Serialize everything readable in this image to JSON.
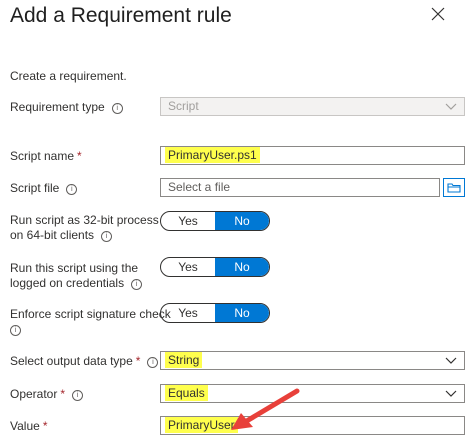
{
  "header": {
    "title": "Add a Requirement rule",
    "close_icon": "close-icon"
  },
  "intro": "Create a requirement.",
  "fields": {
    "requirement_type": {
      "label": "Requirement type",
      "value": "Script"
    },
    "script_name": {
      "label": "Script name",
      "value": "PrimaryUser.ps1"
    },
    "script_file": {
      "label": "Script file",
      "placeholder": "Select a file"
    },
    "run_32bit": {
      "label_line1": "Run script as 32-bit process",
      "label_line2": "on 64-bit clients",
      "yes": "Yes",
      "no": "No"
    },
    "run_credentials": {
      "label_line1": "Run this script using the",
      "label_line2": "logged on credentials",
      "yes": "Yes",
      "no": "No"
    },
    "enforce_signature": {
      "label": "Enforce script signature check",
      "yes": "Yes",
      "no": "No"
    },
    "output_type": {
      "label": "Select output data type",
      "value": "String"
    },
    "operator": {
      "label": "Operator",
      "value": "Equals"
    },
    "value": {
      "label": "Value",
      "value": "PrimaryUser"
    }
  },
  "info_glyph": "i",
  "required_mark": "*",
  "colors": {
    "accent": "#0078d4",
    "highlight": "#ffff4d",
    "arrow": "#e8403a",
    "required": "#a4262c"
  }
}
